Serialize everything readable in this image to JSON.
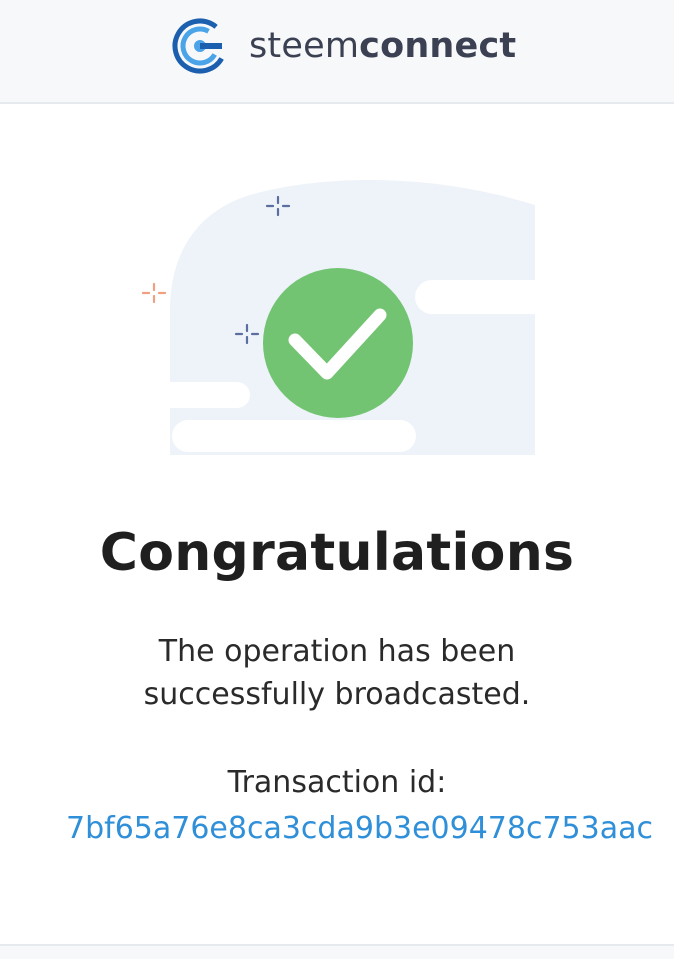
{
  "header": {
    "brand_prefix": "steem",
    "brand_suffix": "connect"
  },
  "main": {
    "title": "Congratulations",
    "message": "The operation has been successfully broadcasted.",
    "transaction_label": "Transaction id:",
    "transaction_id": "7bf65a76e8ca3cda9b3e09478c753aac"
  },
  "icons": {
    "logo": "steemconnect-logo-icon",
    "success": "check-circle-icon",
    "sparkles": "sparkle-icon"
  },
  "colors": {
    "brand_blue": "#1b5fae",
    "brand_light_blue": "#4ba3e8",
    "success_green": "#72c472",
    "link_blue": "#2f8fd8",
    "sparkle_blue": "#5a6fa0",
    "sparkle_orange": "#f0a080"
  }
}
